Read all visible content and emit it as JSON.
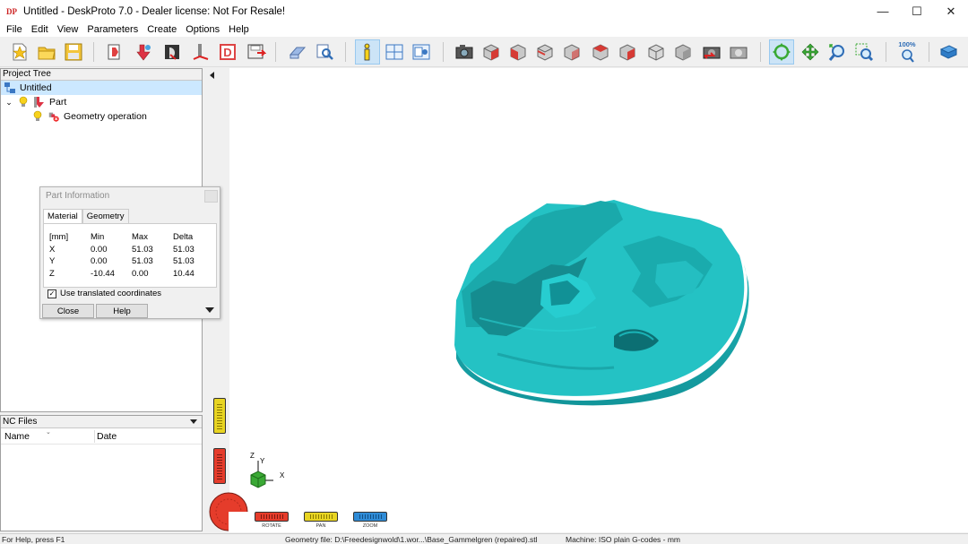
{
  "window": {
    "title": "Untitled - DeskProto 7.0 - Dealer license: Not For Resale!",
    "logo_text": "DP",
    "minimize": "—",
    "maximize": "☐",
    "close": "✕"
  },
  "menu": [
    "File",
    "Edit",
    "View",
    "Parameters",
    "Create",
    "Options",
    "Help"
  ],
  "toolbar": {
    "zoom_level": "100%"
  },
  "project_tree": {
    "header": "Project Tree",
    "root": "Untitled",
    "part": "Part",
    "operation": "Geometry operation"
  },
  "nc_files": {
    "header": "NC Files",
    "col_name": "Name",
    "col_date": "Date"
  },
  "part_info": {
    "title": "Part Information",
    "tabs": [
      "Material",
      "Geometry"
    ],
    "headers": [
      "[mm]",
      "Min",
      "Max",
      "Delta"
    ],
    "rows": [
      [
        "X",
        "0.00",
        "51.03",
        "51.03"
      ],
      [
        "Y",
        "0.00",
        "51.03",
        "51.03"
      ],
      [
        "Z",
        "-10.44",
        "0.00",
        "10.44"
      ]
    ],
    "checkbox_label": "Use translated coordinates",
    "checkbox_checked": true,
    "close_label": "Close",
    "help_label": "Help"
  },
  "view_controls": {
    "rotate": "ROTATE",
    "pan": "PAN",
    "zoom": "ZOOM",
    "axis_x": "X",
    "axis_y": "Y",
    "axis_z": "Z"
  },
  "status": {
    "help": "For Help, press F1",
    "geometry": "Geometry file: D:\\Freedesignwold\\1.wor...\\Base_Gammelgren (repaired).stl",
    "machine": "Machine: ISO plain G-codes - mm"
  },
  "colors": {
    "model": "#22c1c3",
    "model_dark": "#0e8d92",
    "selection": "#cce8ff",
    "rotate": "#e53c2b",
    "pan": "#e8d422",
    "zoom": "#2f8bd6"
  }
}
